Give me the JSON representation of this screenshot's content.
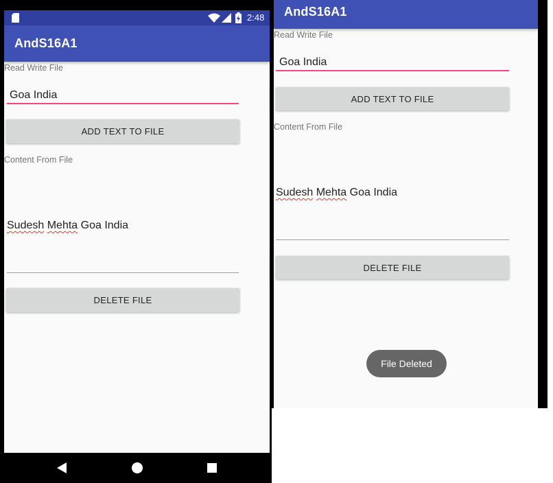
{
  "left_screen": {
    "status_bar": {
      "time": "2:48"
    },
    "app_bar": {
      "title": "AndS16A1"
    },
    "read_write_label": "Read Write File",
    "input_value": "Goa India",
    "add_button_label": "ADD TEXT TO FILE",
    "content_label": "Content From File",
    "content_text": {
      "word1": "Sudesh",
      "word2": "Mehta",
      "rest": " Goa India"
    },
    "delete_button_label": "DELETE FILE",
    "nav_bar": {
      "icons": [
        "back-icon",
        "home-icon",
        "recents-icon"
      ]
    }
  },
  "right_screen": {
    "app_bar": {
      "title": "AndS16A1"
    },
    "read_write_label": "Read Write File",
    "input_value": "Goa India",
    "add_button_label": "ADD TEXT TO FILE",
    "content_label": "Content From File",
    "content_text": {
      "word1": "Sudesh",
      "word2": "Mehta",
      "rest": " Goa India"
    },
    "delete_button_label": "DELETE FILE",
    "toast": "File Deleted"
  },
  "colors": {
    "primary": "#3f51b5",
    "primary_dark": "#303f9f",
    "accent": "#ff4081",
    "button": "#d6d7d7",
    "toast": "#666666"
  }
}
